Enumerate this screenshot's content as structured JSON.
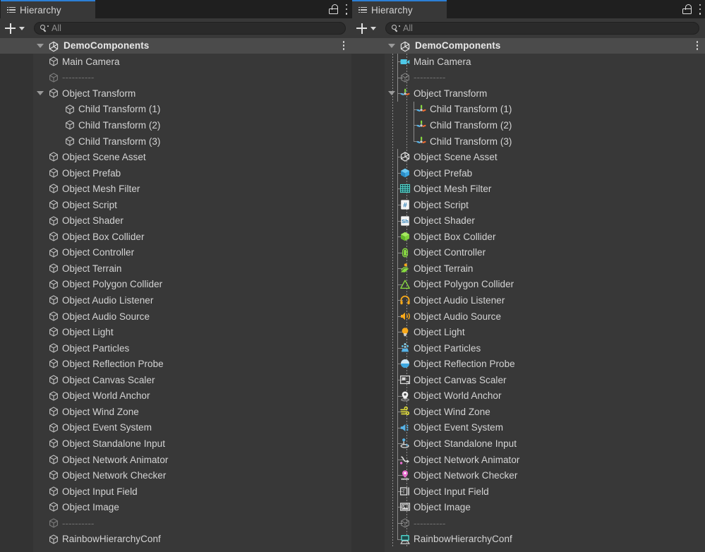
{
  "window": {
    "tab_title": "Hierarchy",
    "tab_icon": "hierarchy-list-icon",
    "lock_icon": "unlocked-padlock-icon",
    "menu_icon": "kebab-menu-icon"
  },
  "toolbar": {
    "add_label": "+",
    "add_icon": "plus-icon",
    "dropdown_icon": "chevron-down-icon",
    "search_icon": "search-dropdown-icon",
    "search_value": "All",
    "search_placeholder": "All"
  },
  "scene": {
    "name": "DemoComponents",
    "icon": "unity-scene-icon",
    "expanded": true,
    "foldout_icon": "triangle-down-icon",
    "menu_icon": "kebab-menu-icon"
  },
  "colors": {
    "panel_bg": "#383838",
    "scene_row_bg": "#4b4b4b",
    "tab_accent": "#2c7fd6",
    "text": "#d4d4d4",
    "dim_text": "#6f6f6f",
    "tree_line": "#8d8d8d",
    "cyan": "#4ec9e8",
    "green": "#8ade41",
    "orange": "#f8a91b",
    "yellow": "#e6e23a",
    "blue": "#56b3e8",
    "pink": "#e96fd0",
    "teal": "#4fd8d0",
    "white": "#e8e8e8"
  },
  "panels": [
    {
      "id": "left-panel",
      "title": "Hierarchy",
      "tree_lines": false,
      "icon_style": "default-grey-cube",
      "items": [
        {
          "label": "Main Camera",
          "depth": 1,
          "icon": "cube-icon"
        },
        {
          "label": "----------",
          "depth": 1,
          "icon": "cube-icon",
          "dim": true,
          "separator": true
        },
        {
          "label": "Object Transform",
          "depth": 1,
          "icon": "cube-icon",
          "foldout": "expanded"
        },
        {
          "label": "Child Transform (1)",
          "depth": 2,
          "icon": "cube-icon"
        },
        {
          "label": "Child Transform (2)",
          "depth": 2,
          "icon": "cube-icon"
        },
        {
          "label": "Child Transform (3)",
          "depth": 2,
          "icon": "cube-icon"
        },
        {
          "label": "Object Scene Asset",
          "depth": 1,
          "icon": "cube-icon"
        },
        {
          "label": "Object Prefab",
          "depth": 1,
          "icon": "cube-icon"
        },
        {
          "label": "Object Mesh Filter",
          "depth": 1,
          "icon": "cube-icon"
        },
        {
          "label": "Object Script",
          "depth": 1,
          "icon": "cube-icon"
        },
        {
          "label": "Object Shader",
          "depth": 1,
          "icon": "cube-icon"
        },
        {
          "label": "Object Box Collider",
          "depth": 1,
          "icon": "cube-icon"
        },
        {
          "label": "Object Controller",
          "depth": 1,
          "icon": "cube-icon"
        },
        {
          "label": "Object Terrain",
          "depth": 1,
          "icon": "cube-icon"
        },
        {
          "label": "Object Polygon Collider",
          "depth": 1,
          "icon": "cube-icon"
        },
        {
          "label": "Object Audio Listener",
          "depth": 1,
          "icon": "cube-icon"
        },
        {
          "label": "Object Audio Source",
          "depth": 1,
          "icon": "cube-icon"
        },
        {
          "label": "Object Light",
          "depth": 1,
          "icon": "cube-icon"
        },
        {
          "label": "Object Particles",
          "depth": 1,
          "icon": "cube-icon"
        },
        {
          "label": "Object Reflection Probe",
          "depth": 1,
          "icon": "cube-icon"
        },
        {
          "label": "Object Canvas Scaler",
          "depth": 1,
          "icon": "cube-icon"
        },
        {
          "label": "Object World Anchor",
          "depth": 1,
          "icon": "cube-icon"
        },
        {
          "label": "Object Wind Zone",
          "depth": 1,
          "icon": "cube-icon"
        },
        {
          "label": "Object Event System",
          "depth": 1,
          "icon": "cube-icon"
        },
        {
          "label": "Object Standalone Input",
          "depth": 1,
          "icon": "cube-icon"
        },
        {
          "label": "Object Network Animator",
          "depth": 1,
          "icon": "cube-icon"
        },
        {
          "label": "Object Network Checker",
          "depth": 1,
          "icon": "cube-icon"
        },
        {
          "label": "Object Input Field",
          "depth": 1,
          "icon": "cube-icon"
        },
        {
          "label": "Object Image",
          "depth": 1,
          "icon": "cube-icon"
        },
        {
          "label": "----------",
          "depth": 1,
          "icon": "cube-icon",
          "dim": true,
          "separator": true
        },
        {
          "label": "RainbowHierarchyConf",
          "depth": 1,
          "icon": "cube-icon"
        }
      ]
    },
    {
      "id": "right-panel",
      "title": "Hierarchy",
      "tree_lines": true,
      "icon_style": "rainbow-component-icons",
      "items": [
        {
          "label": "Main Camera",
          "depth": 1,
          "icon": "camera-icon"
        },
        {
          "label": "----------",
          "depth": 1,
          "icon": "cube-icon",
          "dim": true,
          "separator": true
        },
        {
          "label": "Object Transform",
          "depth": 1,
          "icon": "transform-icon",
          "foldout": "expanded"
        },
        {
          "label": "Child Transform (1)",
          "depth": 2,
          "icon": "transform-icon"
        },
        {
          "label": "Child Transform (2)",
          "depth": 2,
          "icon": "transform-icon"
        },
        {
          "label": "Child Transform (3)",
          "depth": 2,
          "icon": "transform-icon"
        },
        {
          "label": "Object Scene Asset",
          "depth": 1,
          "icon": "unity-scene-icon"
        },
        {
          "label": "Object Prefab",
          "depth": 1,
          "icon": "prefab-icon"
        },
        {
          "label": "Object Mesh Filter",
          "depth": 1,
          "icon": "mesh-filter-icon"
        },
        {
          "label": "Object Script",
          "depth": 1,
          "icon": "csharp-script-icon"
        },
        {
          "label": "Object Shader",
          "depth": 1,
          "icon": "shader-icon"
        },
        {
          "label": "Object Box Collider",
          "depth": 1,
          "icon": "box-collider-icon"
        },
        {
          "label": "Object Controller",
          "depth": 1,
          "icon": "character-controller-icon"
        },
        {
          "label": "Object Terrain",
          "depth": 1,
          "icon": "terrain-icon"
        },
        {
          "label": "Object Polygon Collider",
          "depth": 1,
          "icon": "polygon-collider-icon"
        },
        {
          "label": "Object Audio Listener",
          "depth": 1,
          "icon": "audio-listener-icon"
        },
        {
          "label": "Object Audio Source",
          "depth": 1,
          "icon": "audio-source-icon"
        },
        {
          "label": "Object Light",
          "depth": 1,
          "icon": "light-icon"
        },
        {
          "label": "Object Particles",
          "depth": 1,
          "icon": "particles-icon"
        },
        {
          "label": "Object Reflection Probe",
          "depth": 1,
          "icon": "reflection-probe-icon"
        },
        {
          "label": "Object Canvas Scaler",
          "depth": 1,
          "icon": "canvas-scaler-icon"
        },
        {
          "label": "Object World Anchor",
          "depth": 1,
          "icon": "world-anchor-icon"
        },
        {
          "label": "Object Wind Zone",
          "depth": 1,
          "icon": "wind-zone-icon"
        },
        {
          "label": "Object Event System",
          "depth": 1,
          "icon": "event-system-icon"
        },
        {
          "label": "Object Standalone Input",
          "depth": 1,
          "icon": "standalone-input-icon"
        },
        {
          "label": "Object Network Animator",
          "depth": 1,
          "icon": "network-animator-icon"
        },
        {
          "label": "Object Network Checker",
          "depth": 1,
          "icon": "network-checker-icon"
        },
        {
          "label": "Object Input Field",
          "depth": 1,
          "icon": "input-field-icon"
        },
        {
          "label": "Object Image",
          "depth": 1,
          "icon": "image-icon"
        },
        {
          "label": "----------",
          "depth": 1,
          "icon": "cube-icon",
          "dim": true,
          "separator": true
        },
        {
          "label": "RainbowHierarchyConf",
          "depth": 1,
          "icon": "rainbow-config-icon"
        }
      ]
    }
  ]
}
